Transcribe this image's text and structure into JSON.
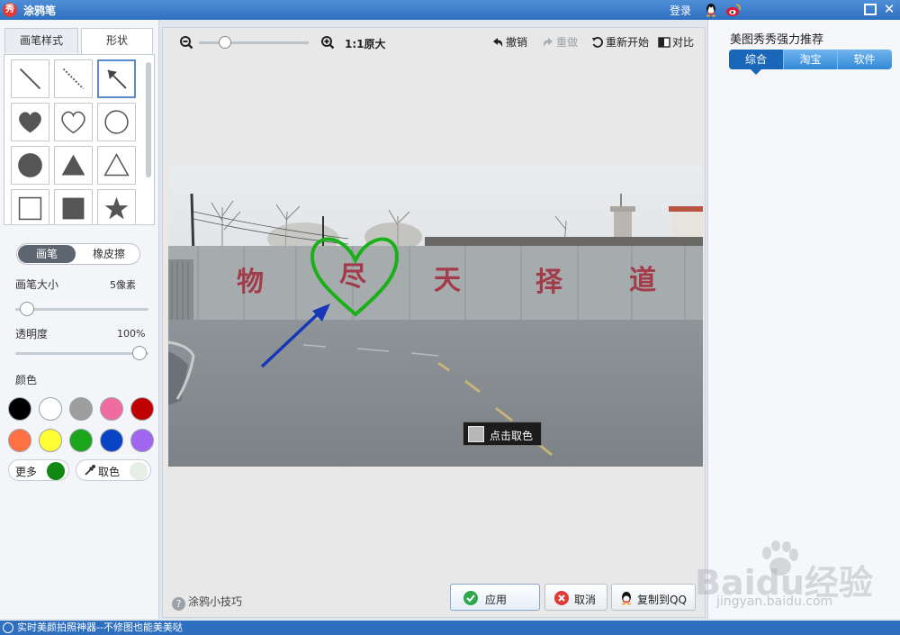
{
  "titlebar": {
    "logo": "秀",
    "title": "涂鸦笔",
    "login": "登录",
    "icons": [
      "qq-icon",
      "weibo-icon",
      "maximize-icon",
      "close-icon"
    ]
  },
  "left_panel": {
    "tabs": [
      {
        "label": "画笔样式",
        "active": false
      },
      {
        "label": "形状",
        "active": true
      }
    ],
    "shapes": [
      "solid-line",
      "dashed-line",
      "arrow",
      "filled-heart",
      "outline-heart",
      "outline-circle",
      "filled-circle",
      "filled-triangle",
      "outline-triangle",
      "outline-square",
      "filled-square",
      "filled-star"
    ],
    "selected_shape": "arrow",
    "mode": {
      "brush": "画笔",
      "eraser": "橡皮擦",
      "active": "brush"
    },
    "brush_size": {
      "label": "画笔大小",
      "value": "5像素",
      "level": 0.05
    },
    "opacity": {
      "label": "透明度",
      "value": "100%",
      "level": 1.0
    },
    "color_label": "颜色",
    "swatches": [
      "#000000",
      "#ffffff",
      "#9e9e9e",
      "#f06ca0",
      "#c00000",
      "#ff7043",
      "#ffff33",
      "#1aa51a",
      "#0a44c4",
      "#a066f0"
    ],
    "more_label": "更多",
    "current_color": "#118811",
    "pick_label": "取色"
  },
  "canvas": {
    "toolbar": {
      "actual_size": "1:1原大",
      "undo": "撤销",
      "redo": "重做",
      "restart": "重新开始",
      "compare": "对比",
      "zoom_level": 0.2
    },
    "wall_text": [
      "物",
      "尽",
      "天",
      "择",
      "道"
    ],
    "color_tip": "点击取色",
    "tips": "涂鸦小技巧",
    "apply": "应用",
    "cancel": "取消",
    "copy_qq": "复制到QQ"
  },
  "right_panel": {
    "title": "美图秀秀强力推荐",
    "tabs": [
      {
        "label": "综合",
        "active": true
      },
      {
        "label": "淘宝",
        "active": false
      },
      {
        "label": "软件",
        "active": false
      }
    ]
  },
  "statusbar": {
    "text": "实时美颜拍照神器--不修图也能美美哒"
  },
  "watermark": {
    "main": "Baidu经验",
    "sub": "jingyan.baidu.com"
  }
}
